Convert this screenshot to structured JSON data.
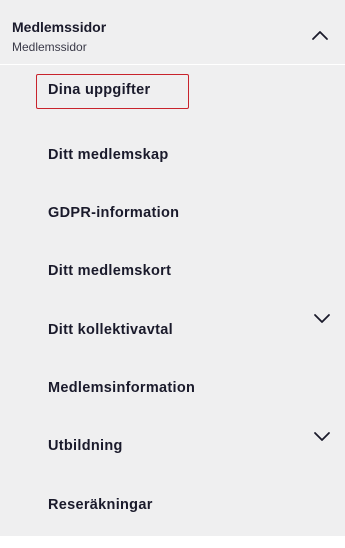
{
  "section": {
    "title": "Medlemssidor",
    "subtitle": "Medlemssidor",
    "toggle_icon": "chevron-up-icon"
  },
  "menu": {
    "items": [
      {
        "label": "Dina uppgifter",
        "selected": true,
        "expandable": false
      },
      {
        "label": "Ditt medlemskap",
        "selected": false,
        "expandable": false
      },
      {
        "label": "GDPR-information",
        "selected": false,
        "expandable": false
      },
      {
        "label": "Ditt medlemskort",
        "selected": false,
        "expandable": false
      },
      {
        "label": "Ditt kollektivavtal",
        "selected": false,
        "expandable": true,
        "icon": "chevron-down-icon"
      },
      {
        "label": "Medlemsinformation",
        "selected": false,
        "expandable": false
      },
      {
        "label": "Utbildning",
        "selected": false,
        "expandable": true,
        "icon": "chevron-down-icon"
      },
      {
        "label": "Reseräkningar",
        "selected": false,
        "expandable": false
      }
    ]
  },
  "colors": {
    "panel_background": "#efeff0",
    "text": "#1a1a2b",
    "selected_outline": "#c8232c"
  }
}
